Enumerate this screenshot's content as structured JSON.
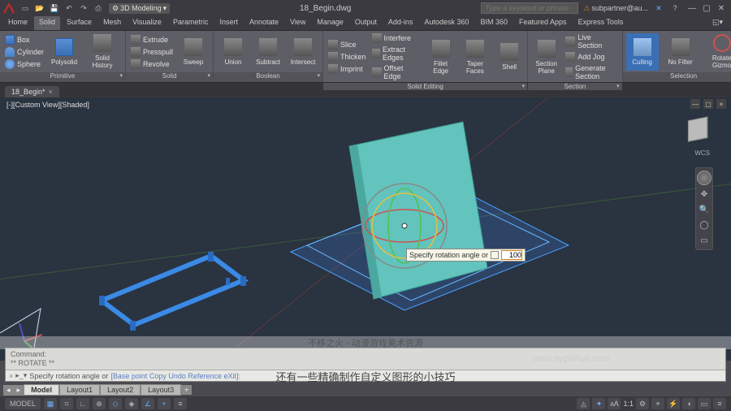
{
  "title": "18_Begin.dwg",
  "workspace": "3D Modeling",
  "search_placeholder": "Type a keyword or phrase",
  "signin": "subpartner@au...",
  "ribbon_tabs": [
    "Home",
    "Solid",
    "Surface",
    "Mesh",
    "Visualize",
    "Parametric",
    "Insert",
    "Annotate",
    "View",
    "Manage",
    "Output",
    "Add-ins",
    "Autodesk 360",
    "BIM 360",
    "Featured Apps",
    "Express Tools"
  ],
  "active_tab": 1,
  "panels": {
    "primitive": {
      "title": "Primitive",
      "box": "Box",
      "cylinder": "Cylinder",
      "sphere": "Sphere",
      "polysolid": "Polysolid",
      "history": "Solid History"
    },
    "solid": {
      "title": "Solid",
      "extrude": "Extrude",
      "presspull": "Presspull",
      "revolve": "Revolve",
      "sweep": "Sweep"
    },
    "boolean": {
      "title": "Boolean",
      "union": "Union",
      "subtract": "Subtract",
      "intersect": "Intersect"
    },
    "solid_editing": {
      "title": "Solid Editing",
      "slice": "Slice",
      "thicken": "Thicken",
      "imprint": "Imprint",
      "interfere": "Interfere",
      "extract": "Extract Edges",
      "offset": "Offset Edge",
      "fillet": "Fillet Edge",
      "taper": "Taper Faces",
      "shell": "Shell"
    },
    "section": {
      "title": "Section",
      "plane": "Section Plane",
      "live": "Live Section",
      "jog": "Add Jog",
      "generate": "Generate Section"
    },
    "selection": {
      "title": "Selection",
      "culling": "Culling",
      "filter": "No Filter",
      "gizmo": "Rotate Gizmo"
    }
  },
  "file_tab": "18_Begin*",
  "view_label": "[-][Custom View][Shaded]",
  "wcs": "WCS",
  "tooltip": {
    "text": "Specify rotation angle or",
    "value": "100"
  },
  "cmd": {
    "hist1": "Command:",
    "hist2": "** ROTATE **",
    "prompt": "Specify rotation angle or",
    "opts": "[Base point  Copy  Undo  Reference  eXit]:"
  },
  "layout_tabs": [
    "Model",
    "Layout1",
    "Layout2",
    "Layout3"
  ],
  "status": {
    "model": "MODEL",
    "scale": "1:1"
  },
  "captions": {
    "c1": "不移之火 - 动漫游戏美术资源",
    "c2": "还有一些精确制作自定义图形的小技巧",
    "wm": "www.byzhihuo.com"
  }
}
